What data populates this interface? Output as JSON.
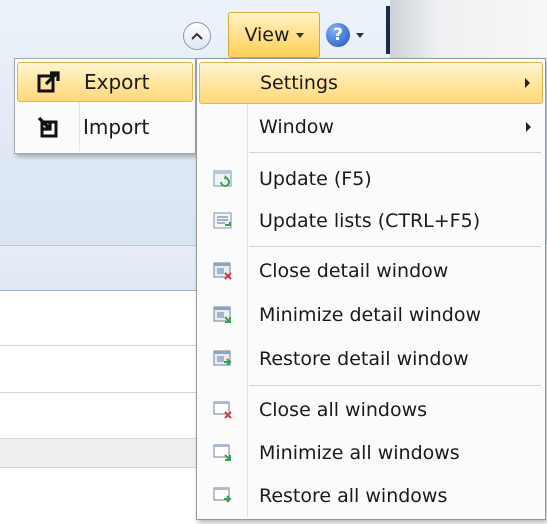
{
  "toolbar": {
    "view_label": "View",
    "help_symbol": "?"
  },
  "submenu": {
    "items": [
      {
        "label": "Export",
        "icon": "export-icon",
        "highlighted": true
      },
      {
        "label": "Import",
        "icon": "import-icon",
        "highlighted": false
      }
    ]
  },
  "menu": {
    "items": [
      {
        "label": "Settings",
        "highlighted": true,
        "submenu": true
      },
      {
        "label": "Window",
        "submenu": true
      },
      {
        "label": "Update (F5)",
        "icon": "update-icon"
      },
      {
        "label": "Update lists (CTRL+F5)",
        "icon": "update-lists-icon"
      },
      {
        "label": "Close detail window",
        "icon": "close-detail-window-icon"
      },
      {
        "label": "Minimize detail window",
        "icon": "minimize-detail-window-icon"
      },
      {
        "label": "Restore detail window",
        "icon": "restore-detail-window-icon"
      },
      {
        "label": "Close all windows",
        "icon": "close-all-windows-icon"
      },
      {
        "label": "Minimize all windows",
        "icon": "minimize-all-windows-icon"
      },
      {
        "label": "Restore all windows",
        "icon": "restore-all-windows-icon"
      }
    ]
  },
  "colors": {
    "highlight": "#ffe08a",
    "highlight_border": "#e3b44a",
    "ribbon": "#dfe9f5"
  }
}
